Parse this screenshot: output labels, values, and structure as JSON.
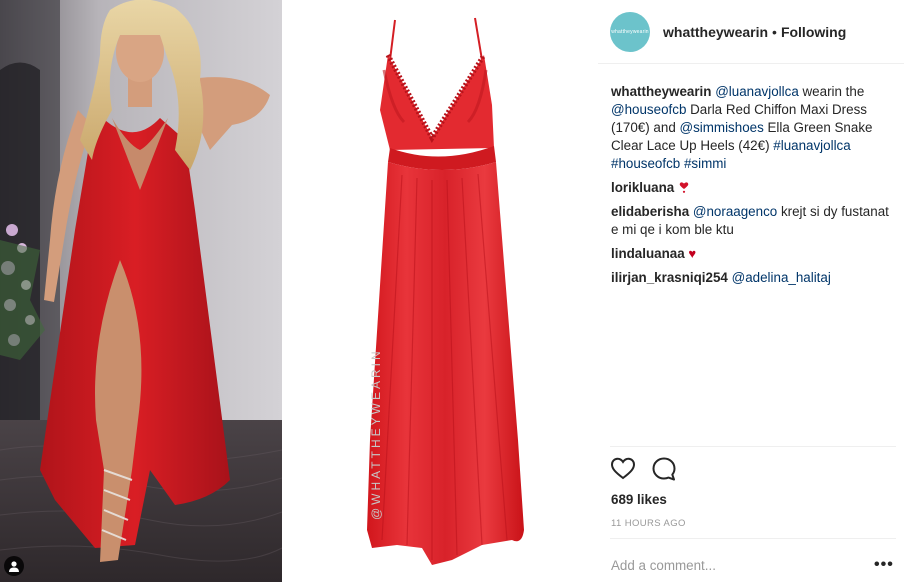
{
  "header": {
    "avatar_text": "whattheywearin",
    "username": "whattheywearin",
    "separator": "•",
    "follow_state": "Following"
  },
  "caption": {
    "user": "whattheywearin",
    "mention_model": "@luanavjollca",
    "text1": " wearin the ",
    "mention_brand": "@houseofcb",
    "text2": " Darla Red Chiffon Maxi Dress (170€) and ",
    "mention_shoes": "@simmishoes",
    "text3": " Ella Green Snake Clear Lace Up Heels (42€) ",
    "hashtag1": "#luanavjollca",
    "hashtag2": "#houseofcb",
    "hashtag3": "#simmi"
  },
  "comments": [
    {
      "user": "lorikluana",
      "text": ""
    },
    {
      "user": "elidaberisha",
      "mention": "@noraagenco",
      "text": " krejt si dy fustanat e mi qe i kom ble ktu"
    },
    {
      "user": "lindaluanaa",
      "text": ""
    },
    {
      "user": "ilirjan_krasniqi254",
      "mention": "@adelina_halitaj",
      "text": ""
    }
  ],
  "emoji": {
    "red_heart": "♥"
  },
  "watermark": "@WHATTHEYWEARIN",
  "likes": "689 likes",
  "time_ago": "11 HOURS AGO",
  "add_comment_placeholder": "Add a comment...",
  "more_label": "•••",
  "icons": {
    "like": "heart-outline-icon",
    "comment": "speech-bubble-icon",
    "more": "ellipsis-icon",
    "user_tag": "person-icon"
  },
  "colors": {
    "link": "#003569",
    "text": "#262626",
    "muted": "#999999",
    "dress_red": "#e0262b",
    "avatar_bg": "#6cc3cb"
  }
}
